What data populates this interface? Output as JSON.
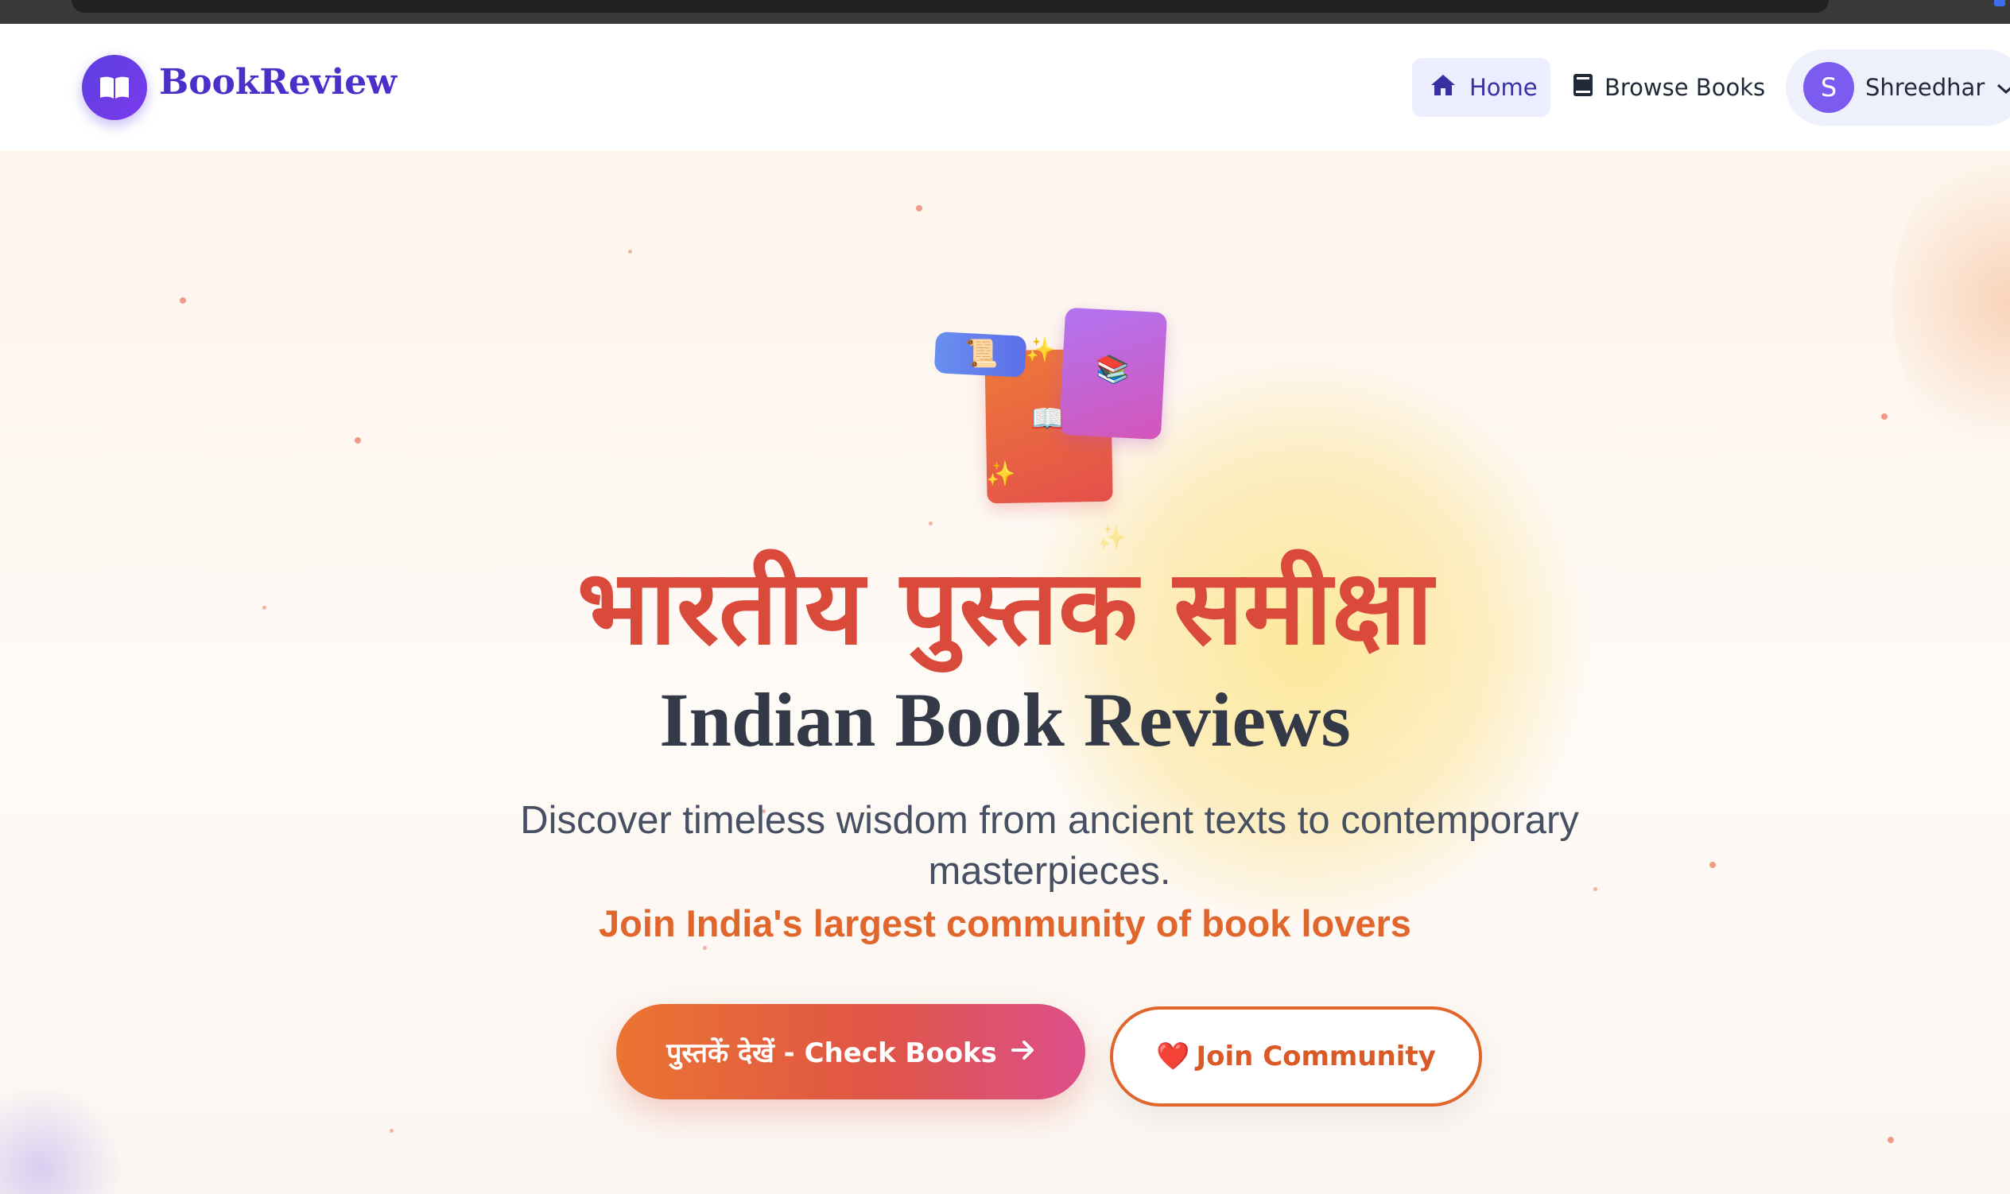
{
  "brand": {
    "name": "BookReview"
  },
  "nav": {
    "home_label": "Home",
    "browse_label": "Browse Books",
    "user": {
      "initial": "S",
      "name": "Shreedhar"
    }
  },
  "hero": {
    "title_hindi": "भारतीय पुस्तक समीक्षा",
    "title_english": "Indian Book Reviews",
    "subtitle": "Discover timeless wisdom from ancient texts to contemporary masterpieces.",
    "tagline": "Join India's largest community of book lovers",
    "primary_button": "पुस्तकें देखें - Check Books",
    "secondary_button_emoji": "❤️",
    "secondary_button": "Join Community",
    "decor_glyphs": {
      "scroll": "📜",
      "book_stack": "📚",
      "open_book": "📖",
      "sparkle": "✨"
    }
  },
  "colors": {
    "brand": "#4c2fc9",
    "accent_orange": "#e0662c",
    "title_red": "#d94a3a",
    "nav_active_bg": "#eceeff"
  }
}
